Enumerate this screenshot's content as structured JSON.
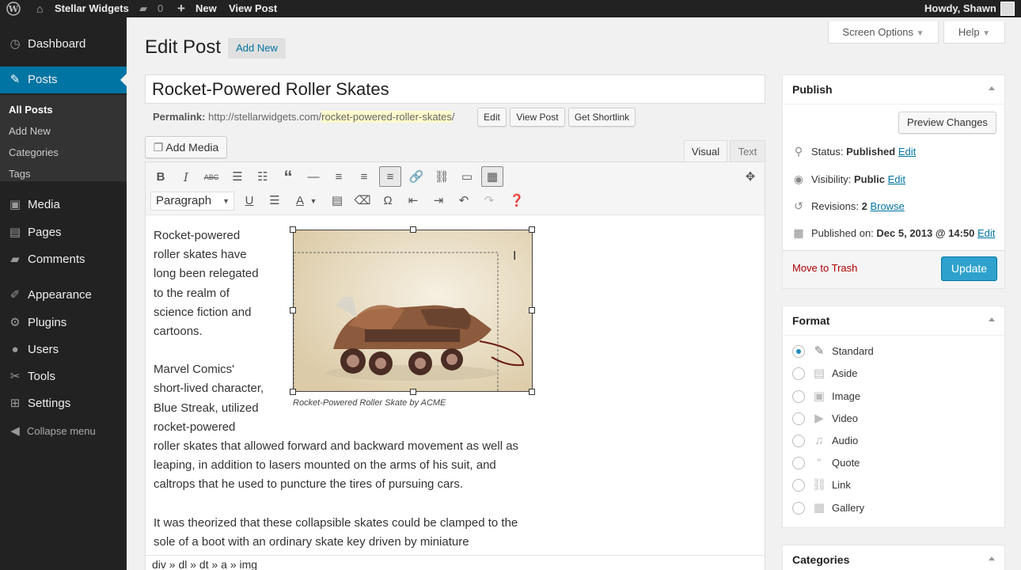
{
  "admin_bar": {
    "site_name": "Stellar Widgets",
    "comments_count": "0",
    "new_label": "New",
    "view_post_label": "View Post",
    "howdy": "Howdy, Shawn"
  },
  "menu": {
    "items": [
      {
        "label": "Dashboard",
        "icon": "dashboard-icon"
      },
      {
        "label": "Posts",
        "icon": "pushpin-icon"
      },
      {
        "label": "Media",
        "icon": "media-icon"
      },
      {
        "label": "Pages",
        "icon": "pages-icon"
      },
      {
        "label": "Comments",
        "icon": "comments-icon"
      },
      {
        "label": "Appearance",
        "icon": "paintbrush-icon"
      },
      {
        "label": "Plugins",
        "icon": "plugin-icon"
      },
      {
        "label": "Users",
        "icon": "users-icon"
      },
      {
        "label": "Tools",
        "icon": "wrench-icon"
      },
      {
        "label": "Settings",
        "icon": "settings-icon"
      }
    ],
    "submenu": [
      "All Posts",
      "Add New",
      "Categories",
      "Tags"
    ],
    "collapse": "Collapse menu"
  },
  "header": {
    "screen_options": "Screen Options",
    "help": "Help",
    "page_title": "Edit Post",
    "add_new": "Add New"
  },
  "post": {
    "title": "Rocket-Powered Roller Skates",
    "permalink_label": "Permalink:",
    "permalink_base": "http://stellarwidgets.com/",
    "permalink_slug": "rocket-powered-roller-skates",
    "permalink_tail": "/",
    "edit_btn": "Edit",
    "view_post_btn": "View Post",
    "shortlink_btn": "Get Shortlink"
  },
  "editor": {
    "add_media": "Add Media",
    "tab_visual": "Visual",
    "tab_text": "Text",
    "format_select": "Paragraph",
    "caption": "Rocket-Powered Roller Skate by ACME",
    "para1_lines": [
      "Rocket-powered",
      "roller skates have",
      "long been relegated",
      "to the realm of",
      "science fiction and",
      "cartoons."
    ],
    "para2_lines": [
      "Marvel Comics'",
      "short-lived character,",
      "Blue Streak, utilized",
      "rocket-powered",
      "roller skates that allowed forward and backward movement as well as",
      "leaping, in addition to lasers mounted on the arms of his suit, and",
      "caltrops that he used to puncture the tires of pursuing cars."
    ],
    "para3_lines": [
      "It was theorized that these collapsible skates could be clamped to the",
      "sole of a boot with an ordinary skate key driven by miniature"
    ],
    "path": "div » dl » dt » a » img"
  },
  "publish": {
    "title": "Publish",
    "preview": "Preview Changes",
    "status_label": "Status:",
    "status_value": "Published",
    "visibility_label": "Visibility:",
    "visibility_value": "Public",
    "revisions_label": "Revisions:",
    "revisions_value": "2",
    "browse": "Browse",
    "published_label": "Published on:",
    "published_value": "Dec 5, 2013 @ 14:50",
    "edit": "Edit",
    "trash": "Move to Trash",
    "update": "Update"
  },
  "format": {
    "title": "Format",
    "options": [
      "Standard",
      "Aside",
      "Image",
      "Video",
      "Audio",
      "Quote",
      "Link",
      "Gallery"
    ],
    "selected": "Standard"
  },
  "categories": {
    "title": "Categories"
  },
  "colors": {
    "accent": "#0074a2",
    "update_button": "#2ea2cc"
  }
}
